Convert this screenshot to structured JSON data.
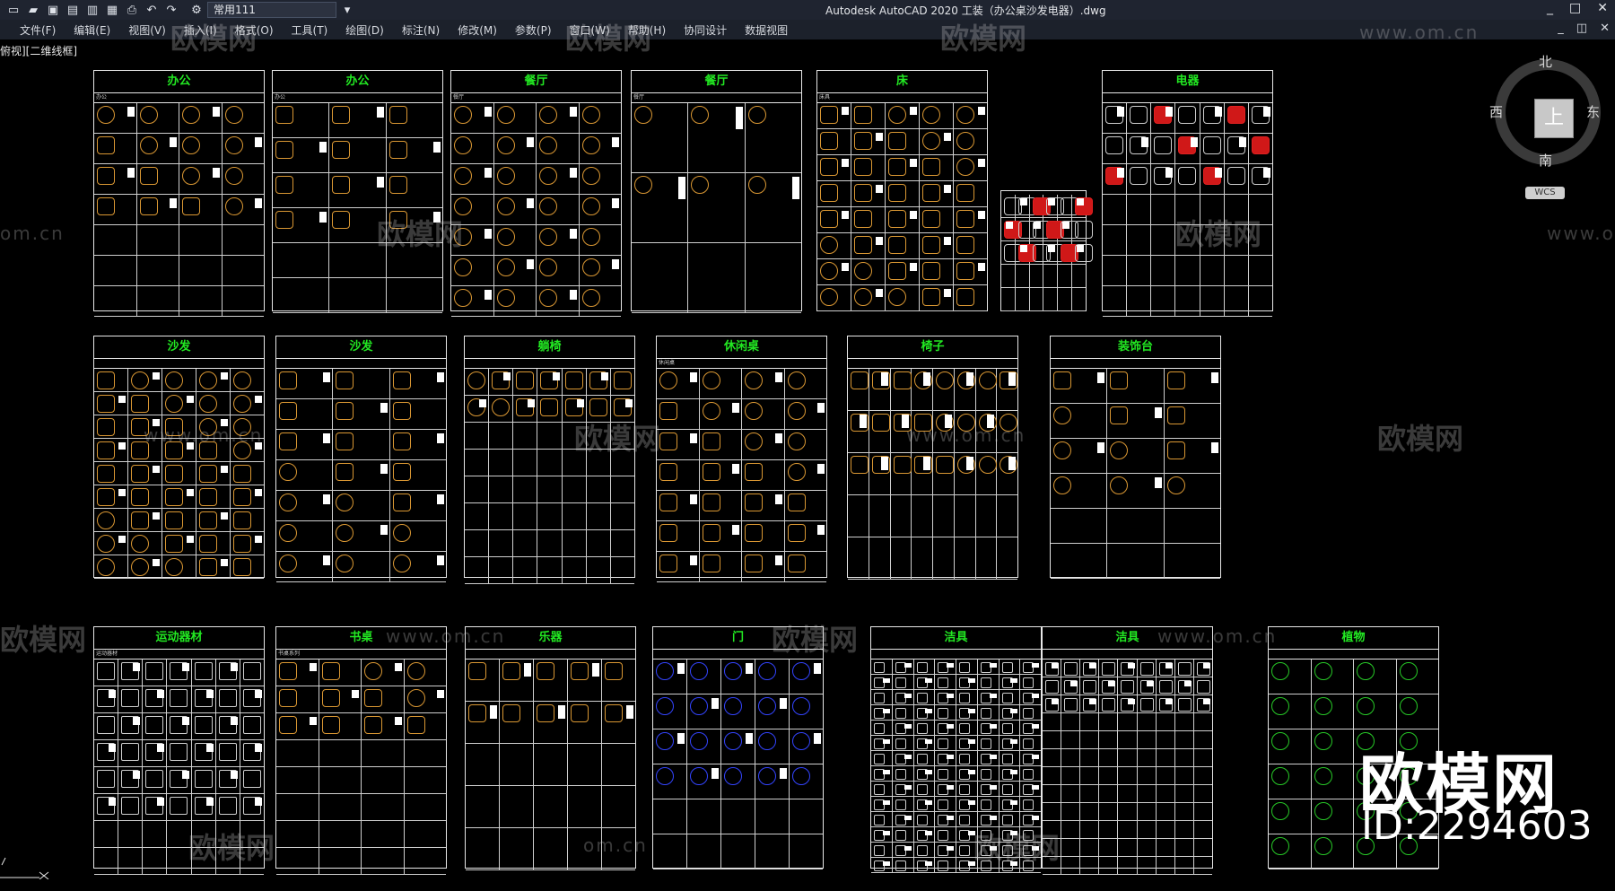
{
  "app": {
    "title": "Autodesk AutoCAD 2020    工装（办公桌沙发电器）.dwg",
    "workspace": "常用111",
    "view_label": "俯视][二维线框]"
  },
  "menu": [
    "文件(F)",
    "编辑(E)",
    "视图(V)",
    "插入(I)",
    "格式(O)",
    "工具(T)",
    "绘图(D)",
    "标注(N)",
    "修改(M)",
    "参数(P)",
    "窗口(W)",
    "帮助(H)",
    "协同设计",
    "数据视图"
  ],
  "window_controls": [
    "_",
    "□",
    "✕"
  ],
  "doc_controls": [
    "_",
    "◫",
    "✕"
  ],
  "viewcube": {
    "north": "北",
    "south": "南",
    "east": "东",
    "west": "西",
    "face": "上",
    "wcs": "WCS"
  },
  "sheets": [
    {
      "title": "办公",
      "sub": "办公"
    },
    {
      "title": "办公",
      "sub": "办公"
    },
    {
      "title": "餐厅",
      "sub": "餐厅"
    },
    {
      "title": "餐厅",
      "sub": "餐厅"
    },
    {
      "title": "床",
      "sub": "床具"
    },
    {
      "title": "",
      "sub": ""
    },
    {
      "title": "电器",
      "sub": ""
    },
    {
      "title": "沙发",
      "sub": ""
    },
    {
      "title": "沙发",
      "sub": ""
    },
    {
      "title": "躺椅",
      "sub": ""
    },
    {
      "title": "休闲桌",
      "sub": "休闲桌"
    },
    {
      "title": "椅子",
      "sub": ""
    },
    {
      "title": "装饰台",
      "sub": ""
    },
    {
      "title": "运动器材",
      "sub": "运动器材"
    },
    {
      "title": "书桌",
      "sub": "书桌系列"
    },
    {
      "title": "乐器",
      "sub": ""
    },
    {
      "title": "门",
      "sub": ""
    },
    {
      "title": "洁具",
      "sub": ""
    },
    {
      "title": "洁具",
      "sub": ""
    },
    {
      "title": "植物",
      "sub": ""
    }
  ],
  "watermarks": {
    "brand": "欧模网",
    "url": "www.om.cn",
    "url_short": "om.cn"
  },
  "brand": {
    "name": "欧模网",
    "id": "ID:2294603"
  },
  "colors": {
    "background": "#000000",
    "title_text": "#22e822",
    "furniture": "#d99733",
    "plants": "#27c927",
    "doors": "#3344ff",
    "frame": "#e8e8e8"
  }
}
